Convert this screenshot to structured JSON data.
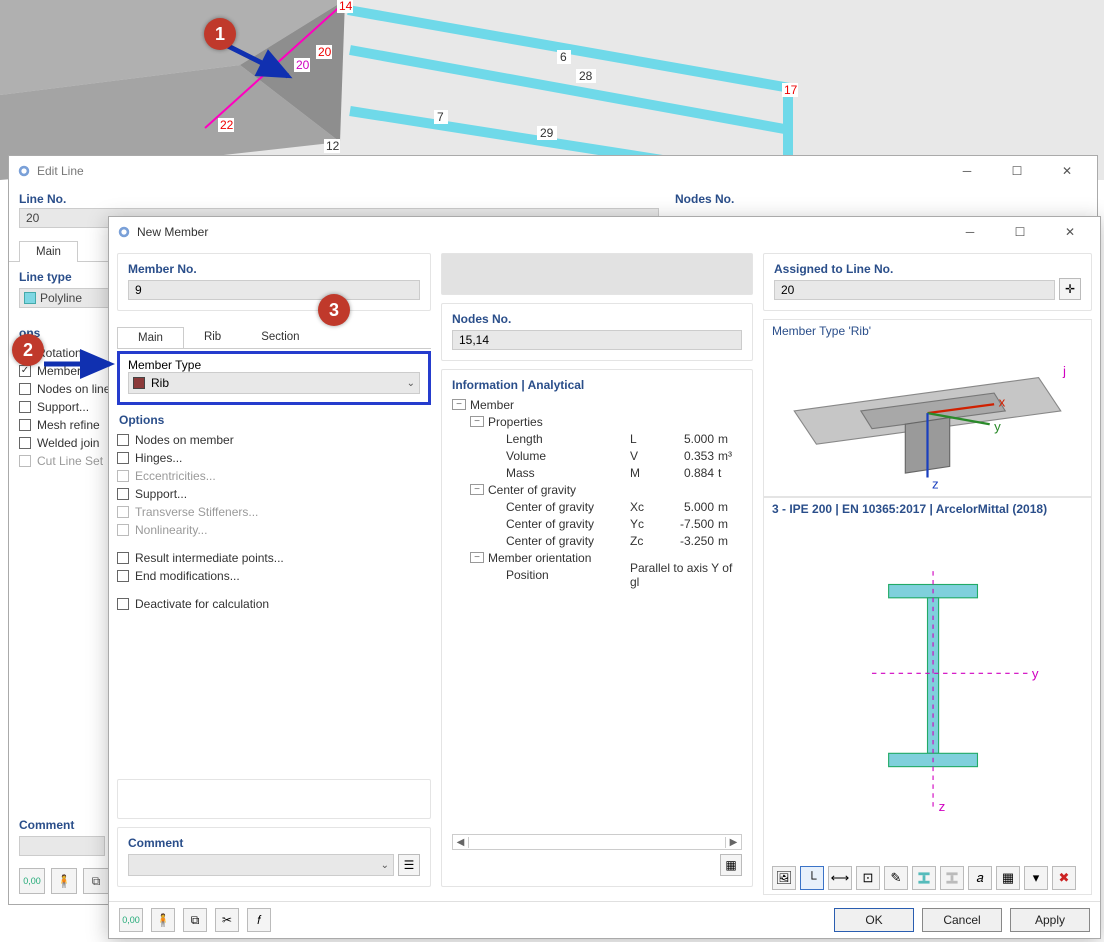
{
  "viewport": {
    "node_labels": [
      "14",
      "20",
      "20",
      "22",
      "12",
      "17"
    ],
    "beam_labels": [
      "6",
      "28",
      "7",
      "29"
    ]
  },
  "callouts": {
    "c1": "1",
    "c2": "2",
    "c3": "3"
  },
  "edit_line": {
    "title": "Edit Line",
    "line_no_label": "Line No.",
    "line_no_value": "20",
    "nodes_no_label": "Nodes No.",
    "tab_main": "Main",
    "line_type_label": "Line type",
    "line_type_value": "Polyline",
    "options_group": "ons",
    "opts": {
      "rotation": "Rotation",
      "member": "Member...",
      "nodes_on_line": "Nodes on line",
      "support": "Support...",
      "mesh_refine": "Mesh refine",
      "welded_joint": "Welded join",
      "cut_line": "Cut Line Set"
    },
    "comment_label": "Comment"
  },
  "new_member": {
    "title": "New Member",
    "member_no_label": "Member No.",
    "member_no_value": "9",
    "assigned_label": "Assigned to Line No.",
    "assigned_value": "20",
    "itabs": {
      "main": "Main",
      "rib": "Rib",
      "section": "Section"
    },
    "member_type_label": "Member Type",
    "member_type_value": "Rib",
    "options_label": "Options",
    "opts": {
      "nodes_on_member": "Nodes on member",
      "hinges": "Hinges...",
      "eccentricities": "Eccentricities...",
      "support": "Support...",
      "transverse": "Transverse Stiffeners...",
      "nonlinearity": "Nonlinearity...",
      "result_intermediate": "Result intermediate points...",
      "end_modifications": "End modifications...",
      "deactivate": "Deactivate for calculation"
    },
    "colB": {
      "nodes_no_label": "Nodes No.",
      "nodes_no_value": "15,14",
      "info_label": "Information | Analytical",
      "tree": {
        "member": "Member",
        "properties": "Properties",
        "length": {
          "label": "Length",
          "sym": "L",
          "val": "5.000",
          "unit": "m"
        },
        "volume": {
          "label": "Volume",
          "sym": "V",
          "val": "0.353",
          "unit": "m³"
        },
        "mass": {
          "label": "Mass",
          "sym": "M",
          "val": "0.884",
          "unit": "t"
        },
        "cog": "Center of gravity",
        "cog_x": {
          "label": "Center of gravity",
          "sym": "Xc",
          "val": "5.000",
          "unit": "m"
        },
        "cog_y": {
          "label": "Center of gravity",
          "sym": "Yc",
          "val": "-7.500",
          "unit": "m"
        },
        "cog_z": {
          "label": "Center of gravity",
          "sym": "Zc",
          "val": "-3.250",
          "unit": "m"
        },
        "orient": "Member orientation",
        "position": {
          "label": "Position",
          "val": "Parallel to axis Y of gl"
        }
      }
    },
    "colC": {
      "preview_title": "Member Type 'Rib'",
      "section_title": "3 - IPE 200 | EN 10365:2017 | ArcelorMittal (2018)",
      "axes": {
        "x": "x",
        "y": "y",
        "z": "z"
      }
    },
    "comment_label": "Comment",
    "buttons": {
      "ok": "OK",
      "cancel": "Cancel",
      "apply": "Apply"
    }
  }
}
